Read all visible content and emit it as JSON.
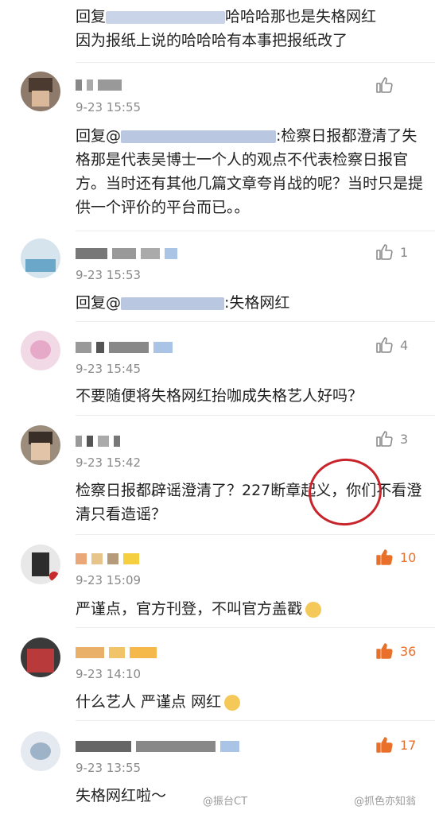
{
  "top_reply": {
    "line1": "哈哈哈那也是失格网红",
    "line2": "因为报纸上说的哈哈哈有本事把报纸改了",
    "prefix": "回复"
  },
  "comments": [
    {
      "time": "9-23 15:55",
      "reply_prefix": "回复@",
      "text_after_mention": ":检察日报都澄清了失格那是代表吴博士一个人的观点不代表检察日报官方。当时还有其他几篇文章夸肖战的呢？当时只是提供一个评价的平台而已。。",
      "likes": ""
    },
    {
      "time": "9-23 15:53",
      "reply_prefix": "回复@",
      "text_after_mention": ":失格网红",
      "likes": "1"
    },
    {
      "time": "9-23 15:45",
      "text": "不要随便将失格网红抬咖成失格艺人好吗？",
      "likes": "4"
    },
    {
      "time": "9-23 15:42",
      "text": "检察日报都辟谣澄清了？227断章起义，你们不看澄清只看造谣？",
      "likes": "3"
    },
    {
      "time": "9-23 15:09",
      "text": "严谨点，官方刊登，不叫官方盖戳",
      "likes": "10"
    },
    {
      "time": "9-23 14:10",
      "text": "什么艺人 严谨点 网红",
      "likes": "36"
    },
    {
      "time": "9-23 13:55",
      "text": "失格网红啦～",
      "likes": "17"
    }
  ],
  "watermarks": {
    "left": "@振台CT",
    "right": "@抓色亦知翁"
  },
  "colors": {
    "like_active": "#e8702a",
    "like_inactive": "#8a8a8a",
    "annotation_circle": "#c8242c"
  }
}
